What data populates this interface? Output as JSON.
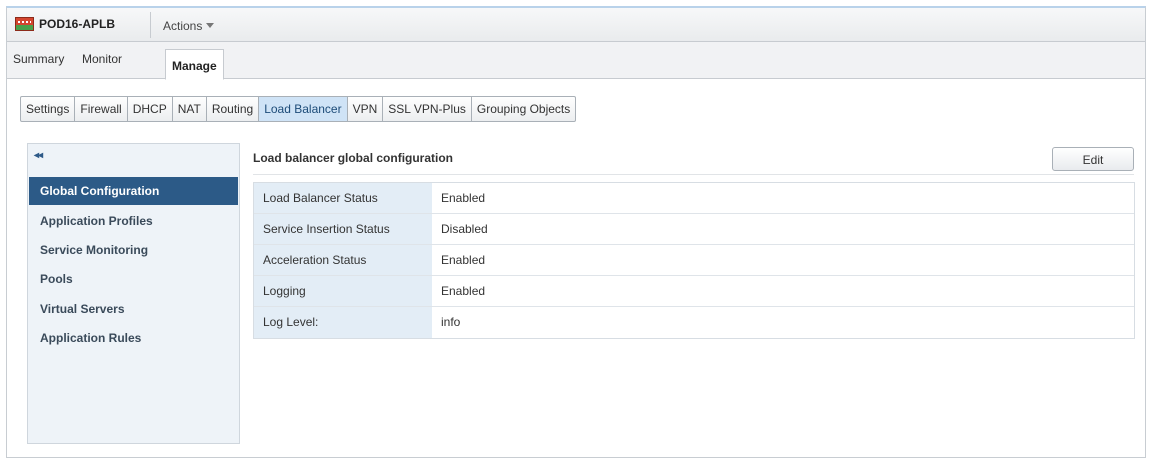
{
  "header": {
    "object_name": "POD16-APLB",
    "actions_label": "Actions"
  },
  "tabs": [
    {
      "label": "Summary",
      "active": false
    },
    {
      "label": "Monitor",
      "active": false
    },
    {
      "label": "Manage",
      "active": true
    }
  ],
  "subtabs": [
    {
      "label": "Settings",
      "active": false
    },
    {
      "label": "Firewall",
      "active": false
    },
    {
      "label": "DHCP",
      "active": false
    },
    {
      "label": "NAT",
      "active": false
    },
    {
      "label": "Routing",
      "active": false
    },
    {
      "label": "Load Balancer",
      "active": true
    },
    {
      "label": "VPN",
      "active": false
    },
    {
      "label": "SSL VPN-Plus",
      "active": false
    },
    {
      "label": "Grouping Objects",
      "active": false
    }
  ],
  "sidebar": {
    "collapse_glyph": "◂◂",
    "items": [
      {
        "label": "Global Configuration",
        "selected": true
      },
      {
        "label": "Application Profiles",
        "selected": false
      },
      {
        "label": "Service Monitoring",
        "selected": false
      },
      {
        "label": "Pools",
        "selected": false
      },
      {
        "label": "Virtual Servers",
        "selected": false
      },
      {
        "label": "Application Rules",
        "selected": false
      }
    ]
  },
  "main": {
    "title": "Load balancer global configuration",
    "edit_label": "Edit",
    "rows": [
      {
        "key": "Load Balancer Status",
        "value": "Enabled"
      },
      {
        "key": "Service Insertion Status",
        "value": "Disabled"
      },
      {
        "key": "Acceleration Status",
        "value": "Enabled"
      },
      {
        "key": "Logging",
        "value": "Enabled"
      },
      {
        "key": "Log Level:",
        "value": "info"
      }
    ]
  },
  "colors": {
    "selected_nav": "#2c5a87",
    "active_subtab": "#cfe3f6",
    "kv_key_bg": "#e3edf6"
  }
}
